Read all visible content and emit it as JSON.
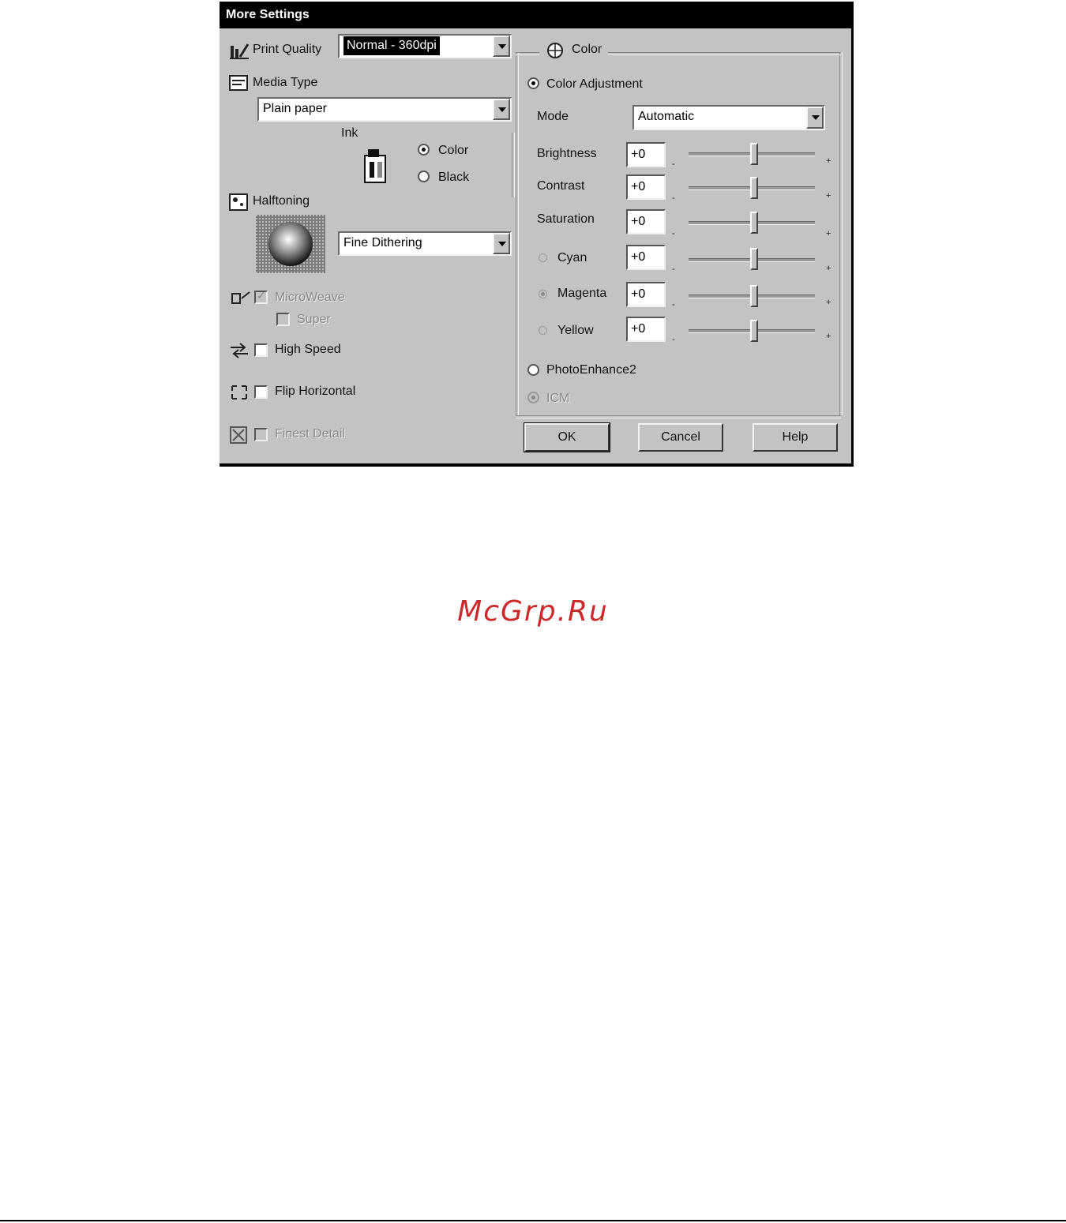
{
  "dialog": {
    "title": "More Settings",
    "print_quality": {
      "label": "Print Quality",
      "value": "Normal - 360dpi"
    },
    "media_type": {
      "label": "Media Type",
      "value": "Plain paper"
    },
    "ink": {
      "label": "Ink",
      "options": [
        "Color",
        "Black"
      ],
      "selected": "Color"
    },
    "halftoning": {
      "label": "Halftoning",
      "value": "Fine Dithering"
    },
    "microweave": {
      "label": "MicroWeave",
      "checked": true,
      "enabled": false
    },
    "super": {
      "label": "Super",
      "checked": false,
      "enabled": false
    },
    "high_speed": {
      "label": "High Speed",
      "checked": false
    },
    "flip_horizontal": {
      "label": "Flip Horizontal",
      "checked": false
    },
    "finest_detail": {
      "label": "Finest Detail",
      "checked": false,
      "enabled": false
    },
    "color_group": {
      "title": "Color",
      "color_adjustment_label": "Color Adjustment",
      "mode": {
        "label": "Mode",
        "value": "Automatic"
      },
      "sliders": [
        {
          "label": "Brightness",
          "value": "+0",
          "minus": "-",
          "plus": "+"
        },
        {
          "label": "Contrast",
          "value": "+0",
          "minus": "-",
          "plus": "+"
        },
        {
          "label": "Saturation",
          "value": "+0",
          "minus": "-",
          "plus": "+"
        },
        {
          "label": "Cyan",
          "value": "+0",
          "minus": "-",
          "plus": "+"
        },
        {
          "label": "Magenta",
          "value": "+0",
          "minus": "-",
          "plus": "+"
        },
        {
          "label": "Yellow",
          "value": "+0",
          "minus": "-",
          "plus": "+"
        }
      ],
      "photoenhance_label": "PhotoEnhance2",
      "icm_label": "ICM"
    },
    "buttons": {
      "ok": "OK",
      "cancel": "Cancel",
      "help": "Help"
    }
  },
  "watermark": "McGrp.Ru",
  "colors": {
    "titlebar": "#000000",
    "face": "#c3c3c3",
    "watermark": "#cc2a2a"
  }
}
